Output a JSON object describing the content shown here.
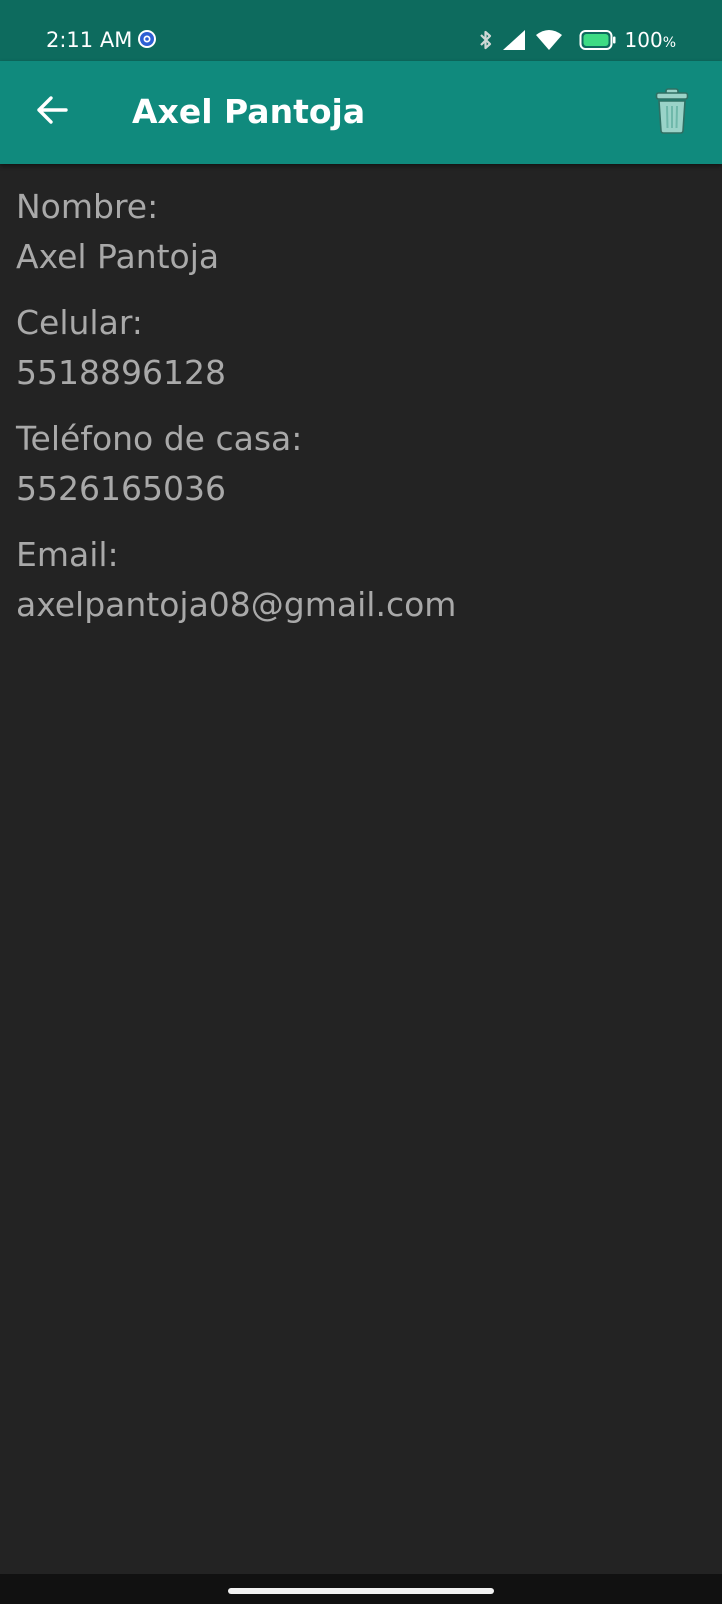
{
  "status_bar": {
    "time": "2:11 AM",
    "app_icon": "blue-gear-icon",
    "bluetooth_icon": "bluetooth-icon",
    "signal_icon": "cell-signal-icon",
    "wifi_icon": "wifi-icon",
    "battery_icon": "battery-icon",
    "battery_level": "100",
    "battery_unit": "%"
  },
  "app_bar": {
    "title": "Axel Pantoja",
    "back_icon": "arrow-left-icon",
    "delete_icon": "trash-icon"
  },
  "contact": {
    "fields": [
      {
        "label": "Nombre:",
        "value": "Axel Pantoja"
      },
      {
        "label": "Celular:",
        "value": "5518896128"
      },
      {
        "label": "Teléfono de casa:",
        "value": "5526165036"
      },
      {
        "label": "Email:",
        "value": "axelpantoja08@gmail.com"
      }
    ]
  },
  "colors": {
    "status_bar": "#0d6b5e",
    "app_bar": "#108a7d",
    "background": "#232323",
    "text": "#a9a9a9",
    "battery": "#3ddc84"
  }
}
